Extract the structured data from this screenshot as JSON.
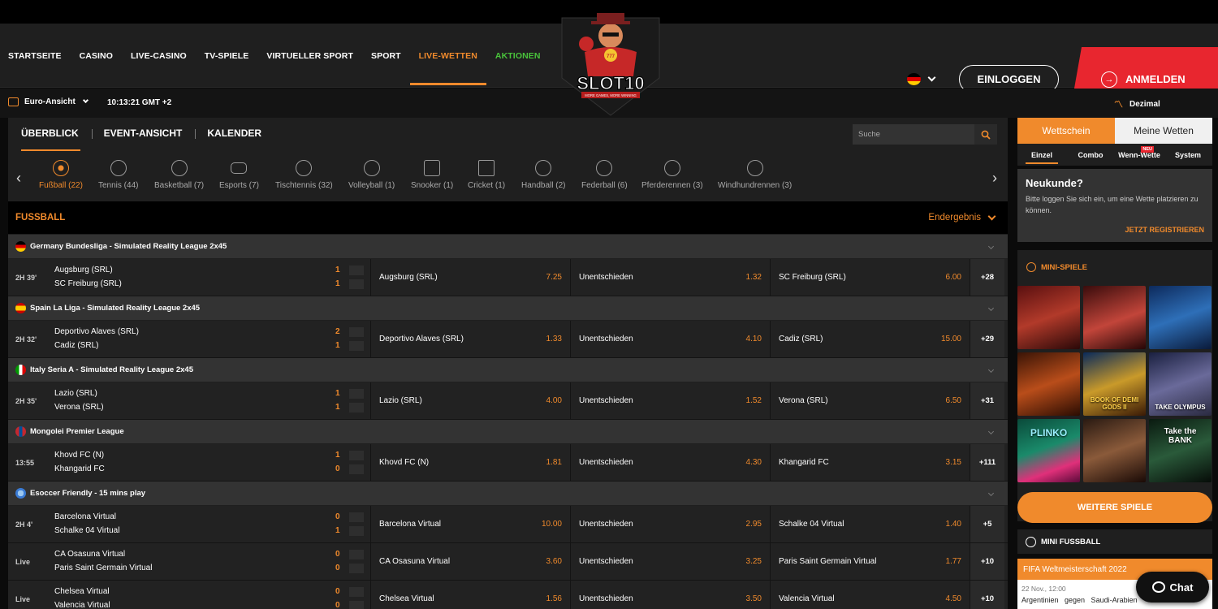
{
  "nav": {
    "items": [
      "STARTSEITE",
      "CASINO",
      "LIVE-CASINO",
      "TV-SPIELE",
      "VIRTUELLER SPORT",
      "SPORT",
      "LIVE-WETTEN",
      "AKTIONEN"
    ],
    "active": "LIVE-WETTEN",
    "login_label": "EINLOGGEN",
    "register_label": "ANMELDEN"
  },
  "logo": {
    "text": "SLOT10",
    "tagline": "MORE GAMES, MORE WINNING"
  },
  "subbar": {
    "view_label": "Euro-Ansicht",
    "time": "10:13:21 GMT +2",
    "odds_format": "Dezimal"
  },
  "tabs": [
    "ÜBERBLICK",
    "EVENT-ANSICHT",
    "KALENDER"
  ],
  "search": {
    "placeholder": "Suche"
  },
  "sports": [
    {
      "label": "Fußball (22)",
      "active": true
    },
    {
      "label": "Tennis (44)"
    },
    {
      "label": "Basketball (7)"
    },
    {
      "label": "Esports (7)"
    },
    {
      "label": "Tischtennis (32)"
    },
    {
      "label": "Volleyball (1)"
    },
    {
      "label": "Snooker (1)"
    },
    {
      "label": "Cricket (1)"
    },
    {
      "label": "Handball (2)"
    },
    {
      "label": "Federball (6)"
    },
    {
      "label": "Pferderennen (3)"
    },
    {
      "label": "Windhundrennen (3)"
    }
  ],
  "section": {
    "title": "FUSSBALL",
    "market": "Endergebnis"
  },
  "leagues": [
    {
      "name": "Germany Bundesliga - Simulated Reality League 2x45",
      "flag": "de",
      "events": [
        {
          "time": "2H 39'",
          "home": "Augsburg (SRL)",
          "away": "SC Freiburg (SRL)",
          "hs": "1",
          "as": "1",
          "o1": "7.25",
          "draw": "Unentschieden",
          "ox": "1.32",
          "o2": "6.00",
          "more": "+28"
        }
      ]
    },
    {
      "name": "Spain La Liga - Simulated Reality League 2x45",
      "flag": "es",
      "events": [
        {
          "time": "2H 32'",
          "home": "Deportivo Alaves (SRL)",
          "away": "Cadiz (SRL)",
          "hs": "2",
          "as": "1",
          "o1": "1.33",
          "draw": "Unentschieden",
          "ox": "4.10",
          "o2": "15.00",
          "more": "+29"
        }
      ]
    },
    {
      "name": "Italy Seria A - Simulated Reality League 2x45",
      "flag": "it",
      "events": [
        {
          "time": "2H 35'",
          "home": "Lazio (SRL)",
          "away": "Verona (SRL)",
          "hs": "1",
          "as": "1",
          "o1": "4.00",
          "draw": "Unentschieden",
          "ox": "1.52",
          "o2": "6.50",
          "more": "+31"
        }
      ]
    },
    {
      "name": "Mongolei Premier League",
      "flag": "mn",
      "events": [
        {
          "time": "13:55",
          "home": "Khovd FC (N)",
          "away": "Khangarid FC",
          "hs": "1",
          "as": "0",
          "o1": "1.81",
          "draw": "Unentschieden",
          "ox": "4.30",
          "o2": "3.15",
          "more": "+111"
        }
      ]
    },
    {
      "name": "Esoccer Friendly - 15 mins play",
      "flag": "world",
      "events": [
        {
          "time": "2H 4'",
          "home": "Barcelona Virtual",
          "away": "Schalke 04 Virtual",
          "hs": "0",
          "as": "1",
          "o1": "10.00",
          "draw": "Unentschieden",
          "ox": "2.95",
          "o2": "1.40",
          "more": "+5"
        },
        {
          "time": "Live",
          "home": "CA Osasuna Virtual",
          "away": "Paris Saint Germain Virtual",
          "hs": "0",
          "as": "0",
          "o1": "3.60",
          "draw": "Unentschieden",
          "ox": "3.25",
          "o2": "1.77",
          "more": "+10"
        },
        {
          "time": "Live",
          "home": "Chelsea Virtual",
          "away": "Valencia Virtual",
          "hs": "0",
          "as": "0",
          "o1": "1.56",
          "draw": "Unentschieden",
          "ox": "3.50",
          "o2": "4.50",
          "more": "+10"
        }
      ]
    }
  ],
  "betslip": {
    "tabs": [
      "Wettschein",
      "Meine Wetten"
    ],
    "subtabs": [
      "Einzel",
      "Combo",
      "Wenn-Wette",
      "System"
    ],
    "new_badge": "NEU",
    "new_title": "Neukunde?",
    "new_text": "Bitte loggen Sie sich ein, um eine Wette platzieren zu können.",
    "register_link": "JETZT REGISTRIEREN"
  },
  "mini_games": {
    "title": "MINI-SPIELE",
    "games": [
      "",
      "",
      "",
      "",
      "BOOK OF DEMI GODS II",
      "TAKE OLYMPUS",
      "PLINKO",
      "",
      "Take the BANK"
    ],
    "more_label": "WEITERE SPIELE"
  },
  "mini_football": {
    "title": "MINI FUSSBALL",
    "competition": "FIFA Weltmeisterschaft 2022",
    "date": "22 Nov., 12:00",
    "match": "Argentinien   gegen   Saudi-Arabien"
  },
  "chat_label": "Chat",
  "colors": {
    "accent": "#f08a2c",
    "register": "#e8262f",
    "promo": "#49c43b"
  }
}
